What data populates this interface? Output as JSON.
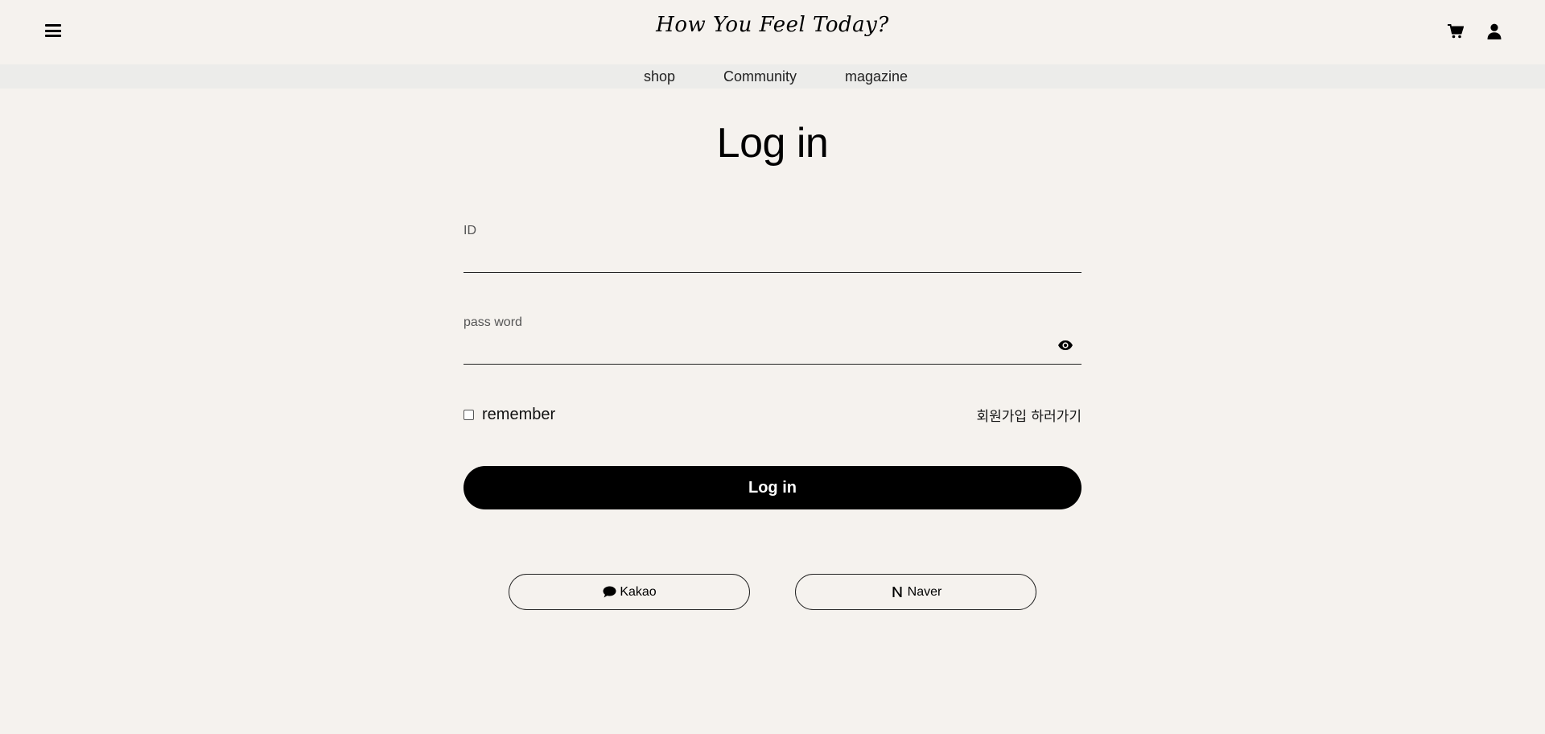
{
  "header": {
    "logo_text": "How You Feel Today?",
    "menu_icon": "hamburger-menu-icon",
    "cart_icon": "cart-icon",
    "user_icon": "user-icon"
  },
  "nav": {
    "items": [
      {
        "label": "shop"
      },
      {
        "label": "Community"
      },
      {
        "label": "magazine"
      }
    ]
  },
  "main": {
    "title": "Log in",
    "id_field": {
      "label": "ID",
      "value": ""
    },
    "password_field": {
      "label": "pass word",
      "value": "",
      "toggle_icon": "eye-icon"
    },
    "remember": {
      "label": "remember",
      "checked": false
    },
    "signup_link": "회원가입 하러가기",
    "login_button": "Log in",
    "social": [
      {
        "label": "Kakao",
        "icon": "chat-bubble-icon"
      },
      {
        "label": "Naver",
        "icon": "naver-n-icon"
      }
    ]
  },
  "colors": {
    "background": "#f5f2ee",
    "nav_background": "#ececea",
    "primary": "#000000"
  }
}
